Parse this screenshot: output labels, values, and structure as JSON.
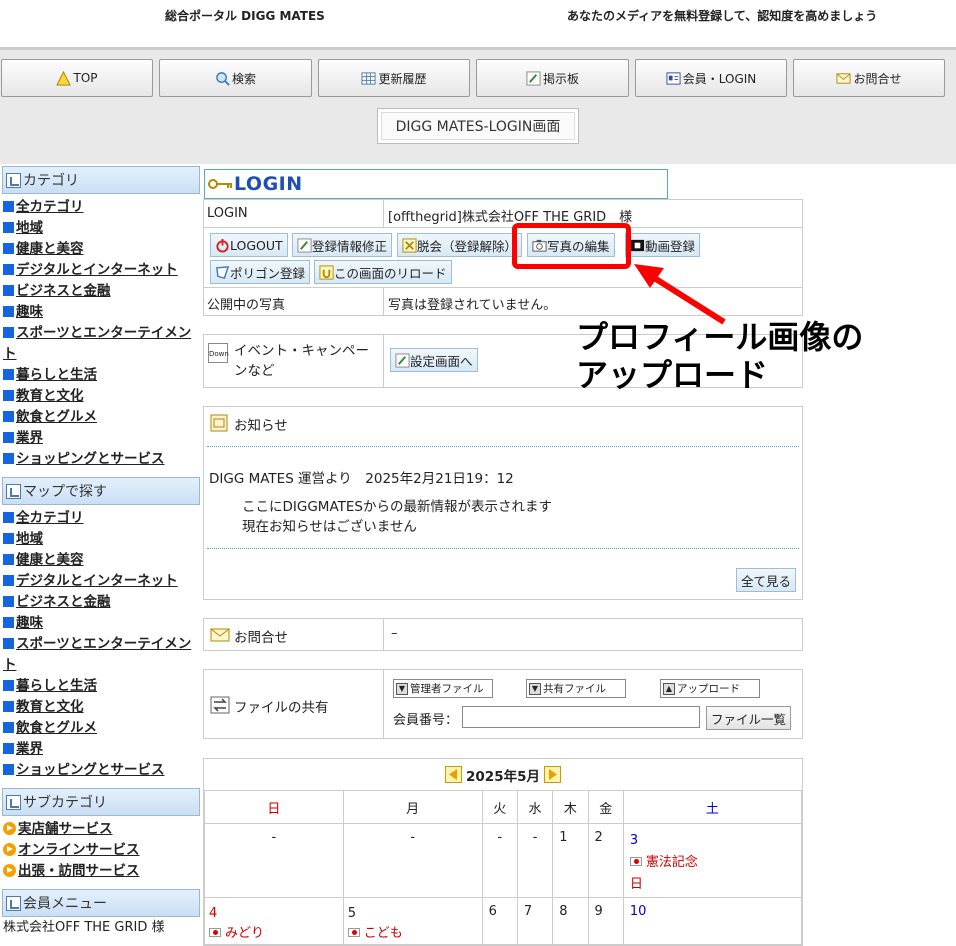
{
  "header": {
    "portal": "総合ポータル DIGG MATES",
    "tagline": "あなたのメディアを無料登録して、認知度を高めましょう"
  },
  "nav": [
    {
      "label": "TOP"
    },
    {
      "label": "検索"
    },
    {
      "label": "更新履歴"
    },
    {
      "label": "掲示板"
    },
    {
      "label": "会員・LOGIN"
    },
    {
      "label": "お問合せ"
    }
  ],
  "page_title": "DIGG MATES-LOGIN画面",
  "sidebar": {
    "category_title": "カテゴリ",
    "categories": [
      "全カテゴリ",
      "地域",
      "健康と美容",
      "デジタルとインターネット",
      "ビジネスと金融",
      "趣味",
      "スポーツとエンターテイメント",
      "暮らしと生活",
      "教育と文化",
      "飲食とグルメ",
      "業界",
      "ショッピングとサービス"
    ],
    "map_title": "マップで探す",
    "map_items": [
      "全カテゴリ",
      "地域",
      "健康と美容",
      "デジタルとインターネット",
      "ビジネスと金融",
      "趣味",
      "スポーツとエンターテイメント",
      "暮らしと生活",
      "教育と文化",
      "飲食とグルメ",
      "業界",
      "ショッピングとサービス"
    ],
    "sub_title": "サブカテゴリ",
    "sub_items": [
      "実店舗サービス",
      "オンラインサービス",
      "出張・訪問サービス"
    ],
    "member_title": "会員メニュー",
    "member_name": "株式会社OFF THE GRID 様"
  },
  "login": {
    "title": "LOGIN",
    "row_label": "LOGIN",
    "user": "[offthegrid]株式会社OFF THE GRID　様",
    "buttons": {
      "logout": "LOGOUT",
      "edit_info": "登録情報修正",
      "withdraw": "脱会（登録解除）",
      "photo_edit": "写真の編集",
      "video": "動画登録",
      "polygon": "ポリゴン登録",
      "reload": "この画面のリロード"
    },
    "public_photo_label": "公開中の写真",
    "public_photo_value": "写真は登録されていません。",
    "event_label": "イベント・キャンペーンなど",
    "event_icon_text": "Down",
    "settings_button": "設定画面へ"
  },
  "callout": {
    "line1": "プロフィール画像の",
    "line2": "アップロード",
    "color": "#ff0000"
  },
  "news": {
    "title": "お知らせ",
    "heading": "DIGG MATES 運営より　2025年2月21日19：12",
    "line1": "ここにDIGGMATESからの最新情報が表示されます",
    "line2": "現在お知らせはございません",
    "all_button": "全て見る"
  },
  "contact": {
    "label": "お問合せ",
    "value": "–"
  },
  "files": {
    "label": "ファイルの共有",
    "admin": "管理者ファイル",
    "shared": "共有ファイル",
    "upload": "アップロード",
    "member_label": "会員番号：",
    "member_value": "",
    "list_button": "ファイル一覧"
  },
  "calendar": {
    "title": "2025年5月",
    "weekdays": [
      "日",
      "月",
      "火",
      "水",
      "木",
      "金",
      "土"
    ],
    "row1": [
      "-",
      "-",
      "-",
      "-",
      "1",
      "2",
      "3"
    ],
    "row2": [
      "4",
      "5",
      "6",
      "7",
      "8",
      "9",
      "10"
    ],
    "holiday_sat": "憲法記念日",
    "holiday_sun": "みどり",
    "holiday_mon": "こども",
    "sun_color": "#cc0000",
    "sat_color": "#0000cc"
  }
}
